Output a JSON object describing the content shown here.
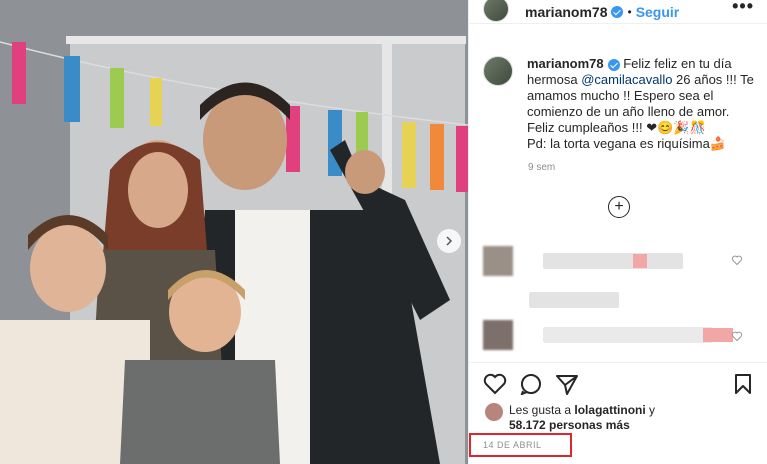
{
  "post": {
    "username": "marianom78",
    "dot": "•",
    "follow_label": "Seguir",
    "more_label": "•••"
  },
  "caption": {
    "username": "marianom78",
    "text_before": " Feliz feliz en tu día hermosa ",
    "mention": "@camilacavallo",
    "text_after": " 26 años !!! Te amamos mucho !! Espero sea el comienzo de un año lleno de amor. Feliz cumpleaños !!! ❤😊🎉🎊",
    "footer_line": "Pd: la torta vegana es riquísima🍰",
    "time_ago": "9 sem"
  },
  "load_more_label": "+",
  "likes": {
    "prefix": "Les gusta a ",
    "user": "lolagattinoni",
    "suffix": " y",
    "count": "58.172 personas más"
  },
  "date": "14 DE ABRIL",
  "icons": [
    "more-icon",
    "verified-icon",
    "heart-icon",
    "comment-icon",
    "share-icon",
    "bookmark-icon",
    "plus-circle-icon",
    "next-arrow-icon"
  ],
  "colors": {
    "accent": "#3897f0",
    "highlight_box": "#e0262a"
  }
}
